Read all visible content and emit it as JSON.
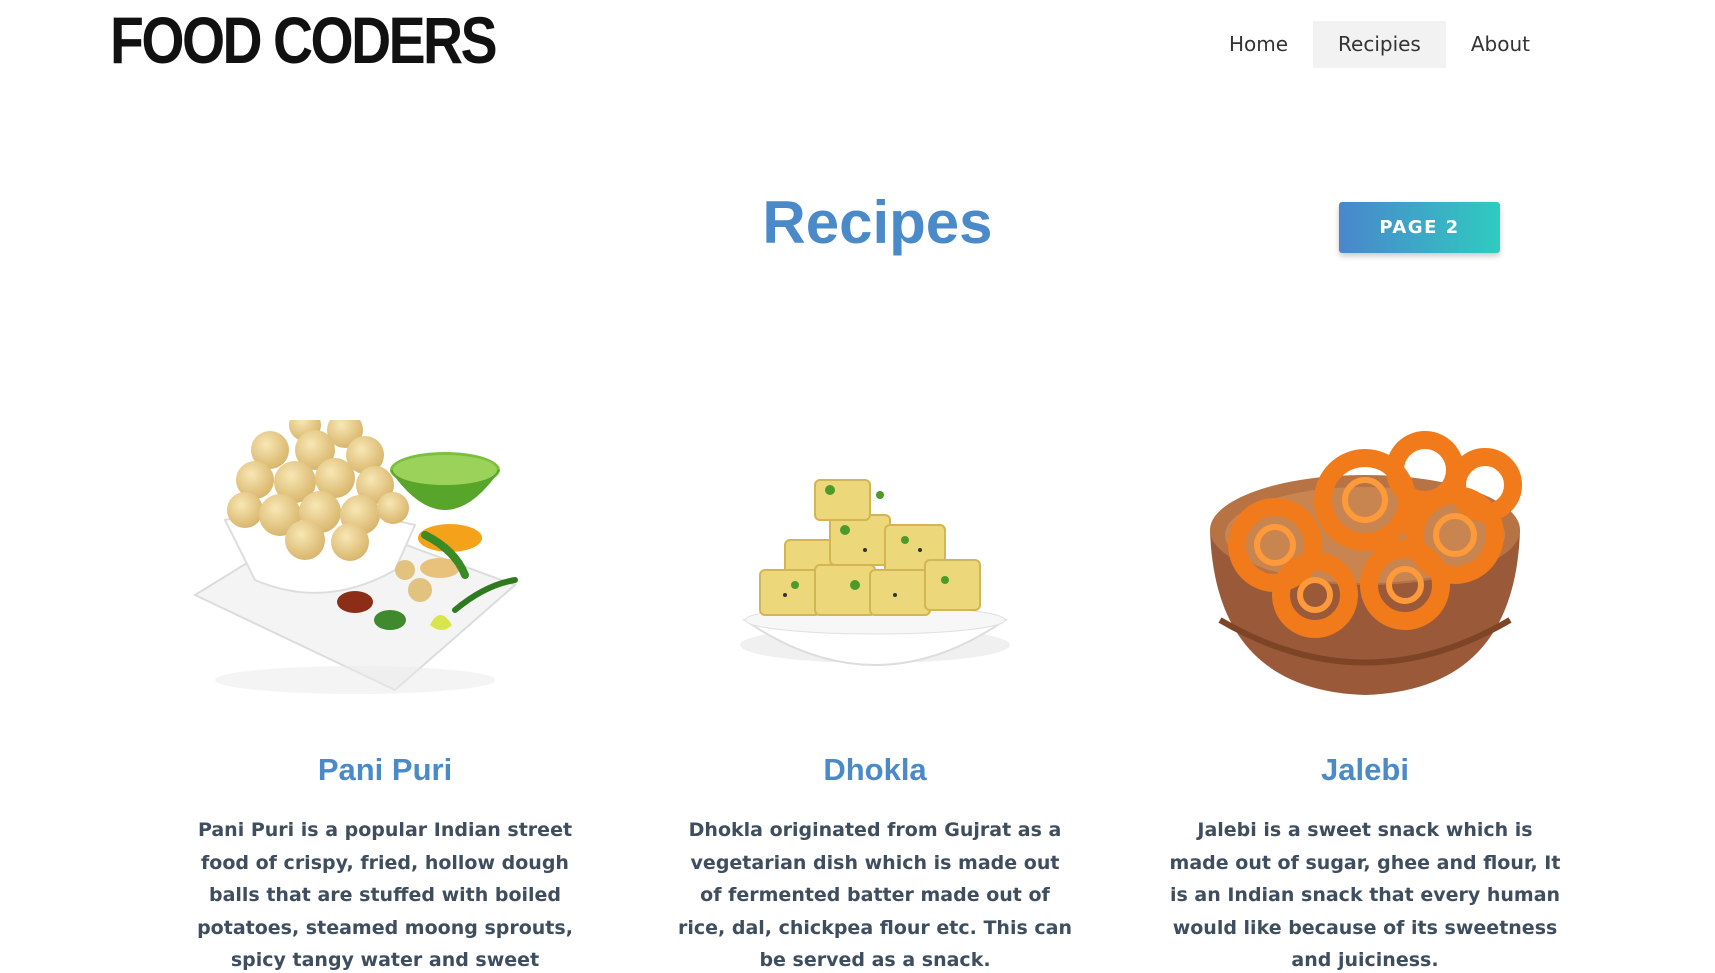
{
  "header": {
    "logo_text": "FOOD CODERS",
    "nav": [
      {
        "label": "Home",
        "active": false
      },
      {
        "label": "Recipies",
        "active": true
      },
      {
        "label": "About",
        "active": false
      }
    ]
  },
  "main": {
    "title": "Recipes",
    "page_button_label": "PAGE 2",
    "cards": [
      {
        "image_icon": "pani-puri-image",
        "title": "Pani Puri",
        "description": "Pani Puri is a popular Indian street food of crispy, fried, hollow dough balls that are stuffed with boiled potatoes, steamed moong sprouts, spicy tangy water and sweet chutney."
      },
      {
        "image_icon": "dhokla-image",
        "title": "Dhokla",
        "description": "Dhokla originated from Gujrat as a vegetarian dish which is made out of fermented batter made out of rice, dal, chickpea flour etc. This can be served as a snack."
      },
      {
        "image_icon": "jalebi-image",
        "title": "Jalebi",
        "description": "Jalebi is a sweet snack which is made out of sugar, ghee and flour, It is an Indian snack that every human would like because of its sweetness and juiciness."
      }
    ]
  },
  "colors": {
    "accent": "#4a8ac9",
    "button_gradient_start": "#4a86cc",
    "button_gradient_end": "#2fcbc0",
    "nav_active_bg": "#f2f2f2",
    "body_text": "#3e4e5f"
  }
}
